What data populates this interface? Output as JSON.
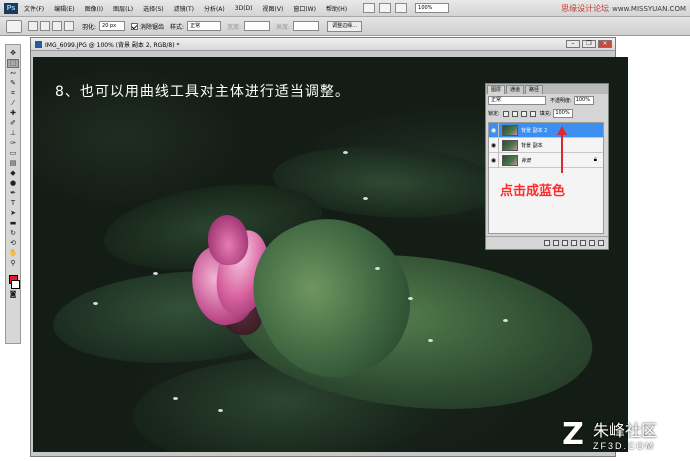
{
  "app": {
    "logo_text": "Ps"
  },
  "menubar": {
    "items": [
      "文件(F)",
      "编辑(E)",
      "图像(I)",
      "图层(L)",
      "选择(S)",
      "滤镜(T)",
      "分析(A)",
      "3D(D)",
      "视图(V)",
      "窗口(W)",
      "帮助(H)"
    ],
    "zoom": "100%"
  },
  "watermark_top": {
    "text": "思缘设计论坛",
    "site": "www.MISSYUAN.COM"
  },
  "options_bar": {
    "feather_label": "羽化:",
    "feather_value": "20 px",
    "antialias_label": "消除锯齿",
    "style_label": "样式:",
    "style_value": "正常",
    "width_label": "宽度:",
    "height_label": "高度:",
    "refine_edge_label": "调整边缘..."
  },
  "document": {
    "title": "IMG_6099.JPG @ 100% (背景 副本 2, RGB/8) *",
    "step_text": "8、也可以用曲线工具对主体进行适当调整。"
  },
  "layers_panel": {
    "tabs": [
      "图层",
      "通道",
      "路径"
    ],
    "blend_mode": "正常",
    "opacity_label": "不透明度:",
    "opacity_value": "100%",
    "lock_label": "锁定:",
    "fill_label": "填充:",
    "fill_value": "100%",
    "layers": [
      {
        "name": "背景 副本 2",
        "selected": true
      },
      {
        "name": "背景 副本",
        "selected": false
      },
      {
        "name": "背景",
        "selected": false
      }
    ]
  },
  "annotation": {
    "text": "点击成蓝色",
    "color": "#ff2b2b"
  },
  "logo": {
    "mark": "Z",
    "name": "朱峰社区",
    "url": "ZF3D.COM"
  },
  "colors": {
    "foreground": "#e21d2c",
    "background": "#ffffff",
    "selection": "#3c8ef0"
  }
}
